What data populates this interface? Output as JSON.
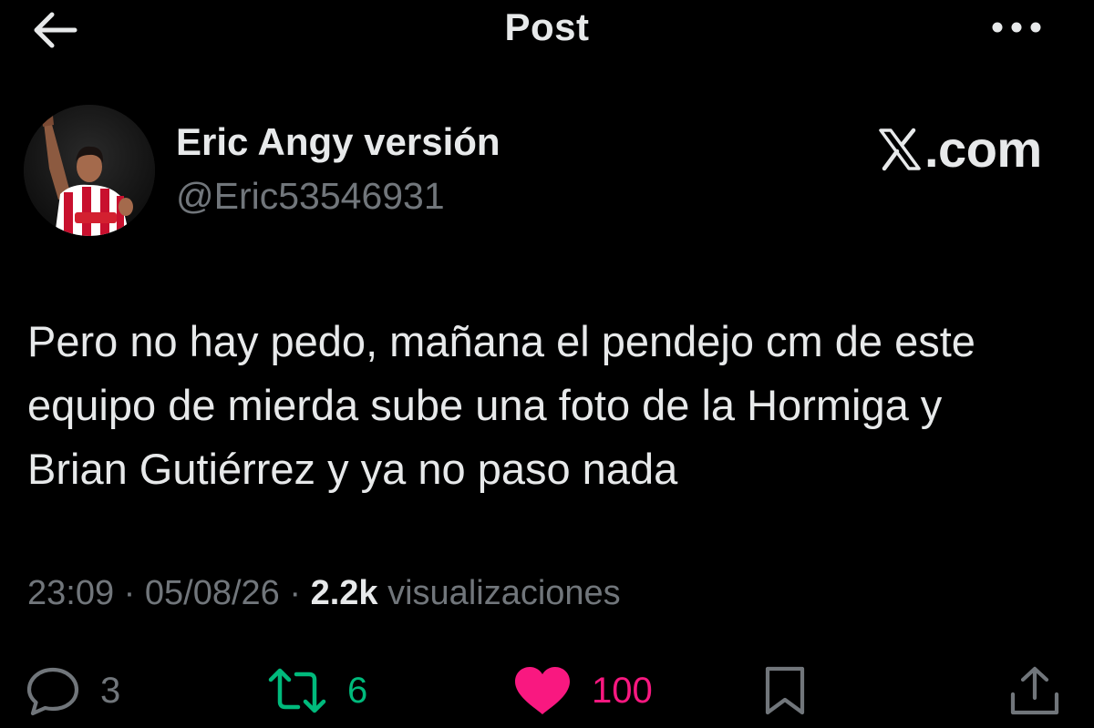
{
  "header": {
    "title": "Post",
    "back_icon": "arrow-left-icon",
    "more_icon": "more-horizontal-icon"
  },
  "author": {
    "name": "Eric Angy versión",
    "handle": "@Eric53546931",
    "avatar_icon": "avatar"
  },
  "brand": {
    "text": ".com",
    "icon": "x-logo-icon"
  },
  "tweet": {
    "text": "Pero no hay pedo, mañana el pendejo cm de este equipo de mierda sube una foto de la Hormiga y Brian Gutiérrez y ya no paso nada"
  },
  "meta": {
    "time": "23:09",
    "separator": " · ",
    "date": "05/08/26",
    "views_count": "2.2k",
    "views_label": " visualizaciones"
  },
  "actions": {
    "replies": "3",
    "retweets": "6",
    "likes": "100"
  },
  "colors": {
    "background": "#000000",
    "text_primary": "#e7e9ea",
    "text_secondary": "#71767b",
    "retweet_green": "#00ba7c",
    "like_pink": "#f91880"
  }
}
